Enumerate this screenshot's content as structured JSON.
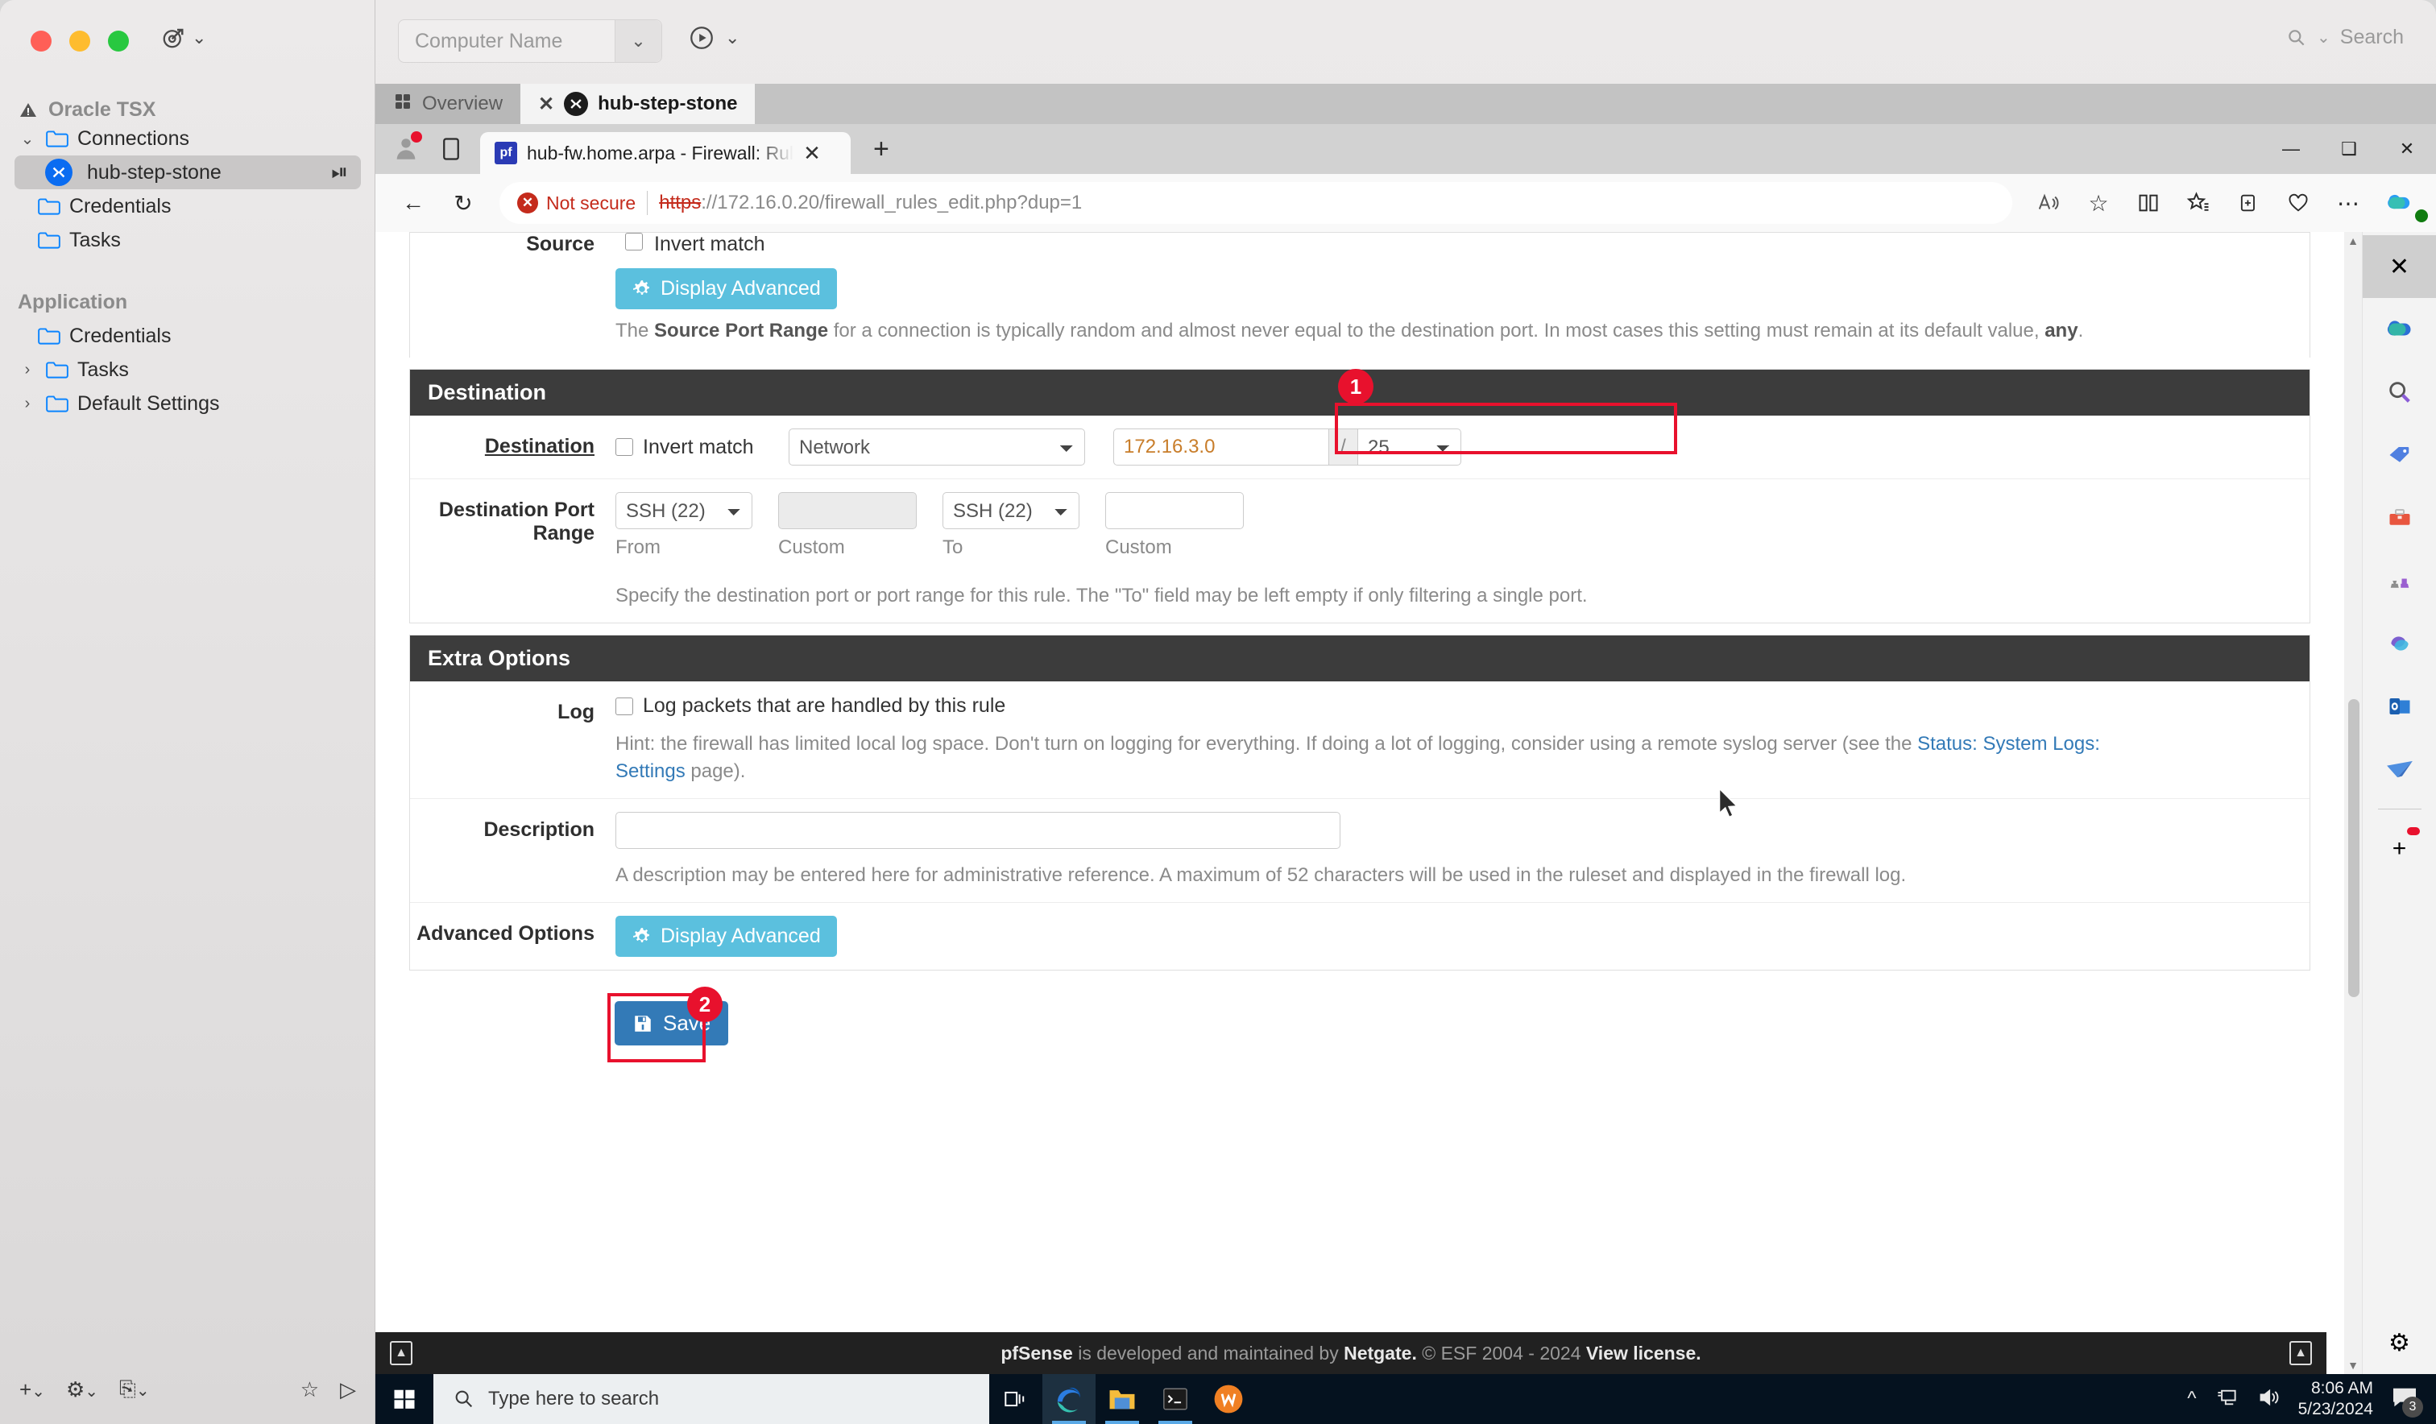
{
  "mac_app": {
    "computer_name_placeholder": "Computer Name",
    "search_placeholder": "Search",
    "sections": [
      {
        "title": "Oracle TSX",
        "items": [
          {
            "label": "Connections",
            "type": "folder",
            "expanded": true,
            "depth": 0
          },
          {
            "label": "hub-step-stone",
            "type": "connection",
            "selected": true,
            "depth": 1
          },
          {
            "label": "Credentials",
            "type": "folder",
            "depth": 0
          },
          {
            "label": "Tasks",
            "type": "folder",
            "depth": 0
          }
        ]
      },
      {
        "title": "Application",
        "items": [
          {
            "label": "Credentials",
            "type": "folder",
            "depth": 0
          },
          {
            "label": "Tasks",
            "type": "folder",
            "collapsed": true,
            "depth": 0
          },
          {
            "label": "Default Settings",
            "type": "folder",
            "collapsed": true,
            "depth": 0
          }
        ]
      }
    ],
    "tabs": [
      {
        "label": "Overview",
        "active": false,
        "icon": "grid-icon"
      },
      {
        "label": "hub-step-stone",
        "active": true,
        "icon": "connection-icon"
      }
    ]
  },
  "browser": {
    "tab_title": "hub-fw.home.arpa - Firewall: Rul",
    "favicon_text": "pf",
    "security_label": "Not secure",
    "url_scheme": "https",
    "url_rest": "://172.16.0.20/firewall_rules_edit.php?dup=1",
    "url_host": "172.16.0.20",
    "window_controls": {
      "minimize": "—",
      "maximize": "❐",
      "close": "✕"
    }
  },
  "page": {
    "source_help_prefix": "The ",
    "source_help_bold": "Source Port Range",
    "source_help_rest": " for a connection is typically random and almost never equal to the destination port. In most cases this setting must remain at its default value, ",
    "source_help_bold2": "any",
    "source_help_end": ".",
    "source_display_advanced": "Display Advanced",
    "destination": {
      "panel_title": "Destination",
      "label": "Destination",
      "invert_match_label": "Invert match",
      "type_value": "Network",
      "address_value": "172.16.3.0",
      "slash": "/",
      "mask_value": "25",
      "port_range_label": "Destination Port Range",
      "from_value": "SSH (22)",
      "from_caption": "From",
      "custom_from_value": "",
      "custom_from_caption": "Custom",
      "to_value": "SSH (22)",
      "to_caption": "To",
      "custom_to_value": "",
      "custom_to_caption": "Custom",
      "help": "Specify the destination port or port range for this rule. The \"To\" field may be left empty if only filtering a single port."
    },
    "extra_options": {
      "panel_title": "Extra Options",
      "log_label": "Log",
      "log_checkbox_label": "Log packets that are handled by this rule",
      "log_help_a": "Hint: the firewall has limited local log space. Don't turn on logging for everything. If doing a lot of logging, consider using a remote syslog server (see the ",
      "log_help_link": "Status: System Logs: Settings",
      "log_help_b": " page).",
      "description_label": "Description",
      "description_value": "",
      "description_help": "A description may be entered here for administrative reference. A maximum of 52 characters will be used in the ruleset and displayed in the firewall log.",
      "advanced_options_label": "Advanced Options",
      "display_advanced_label": "Display Advanced"
    },
    "save_label": "Save",
    "footer": {
      "brand": "pfSense",
      "mid": " is developed and maintained by ",
      "company": "Netgate.",
      "copyright": " © ESF 2004 - 2024 ",
      "license_link": "View license."
    }
  },
  "annotations": [
    {
      "id": "1",
      "target": "destination-address-field"
    },
    {
      "id": "2",
      "target": "save-button"
    }
  ],
  "taskbar": {
    "search_placeholder": "Type here to search",
    "time": "8:06 AM",
    "date": "5/23/2024",
    "notification_count": "3",
    "apps": [
      "task-view-icon",
      "edge-icon",
      "file-explorer-icon",
      "terminal-icon",
      "app-icon"
    ]
  },
  "colors": {
    "accent_red": "#e8112d",
    "pf_header": "#3c3c3c",
    "pf_primary": "#337ab7",
    "pf_info": "#5bc0de",
    "link": "#337ab7"
  }
}
